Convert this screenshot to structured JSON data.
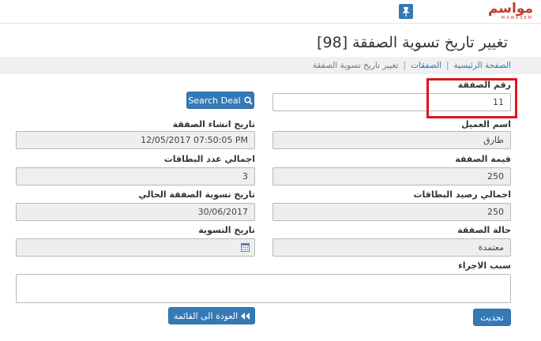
{
  "header": {
    "logo_text": "مواسم",
    "logo_sub": "MAWASEM"
  },
  "page": {
    "title": "تغيير تاريخ تسوية الصفقة [98]"
  },
  "breadcrumb": {
    "home": "الصفحة الرئيسية",
    "deals": "الصفقات",
    "current": "تغيير تاريخ تسوية الصفقة"
  },
  "form": {
    "deal_number": {
      "label": "رقم الصفقة",
      "value": "11"
    },
    "search_field": {
      "value": ""
    },
    "search_button": "Search Deal",
    "client_name": {
      "label": "اسم العميل",
      "value": "طارق"
    },
    "created_date": {
      "label": "تاريخ انشاء الصفقة",
      "value": "12/05/2017 07:50:05 PM"
    },
    "deal_value": {
      "label": "قيمة الصفقة",
      "value": "250"
    },
    "total_cards": {
      "label": "اجمالي عدد البطاقات",
      "value": "3"
    },
    "total_balance": {
      "label": "اجمالي رصيد البطاقات",
      "value": "250"
    },
    "current_settlement": {
      "label": "تاريخ تسوية الصفقة الحالي",
      "value": "30/06/2017"
    },
    "deal_status": {
      "label": "حالة الصفقة",
      "value": "معتمدة"
    },
    "settlement_date": {
      "label": "تاريخ التسوية",
      "value": ""
    },
    "reason": {
      "label": "سبب الاجراء",
      "value": ""
    }
  },
  "actions": {
    "update": "تحديث",
    "back": "العودة الى القائمة"
  },
  "colors": {
    "primary": "#337ab7",
    "highlight": "#e0141e",
    "logo": "#c0392b"
  }
}
